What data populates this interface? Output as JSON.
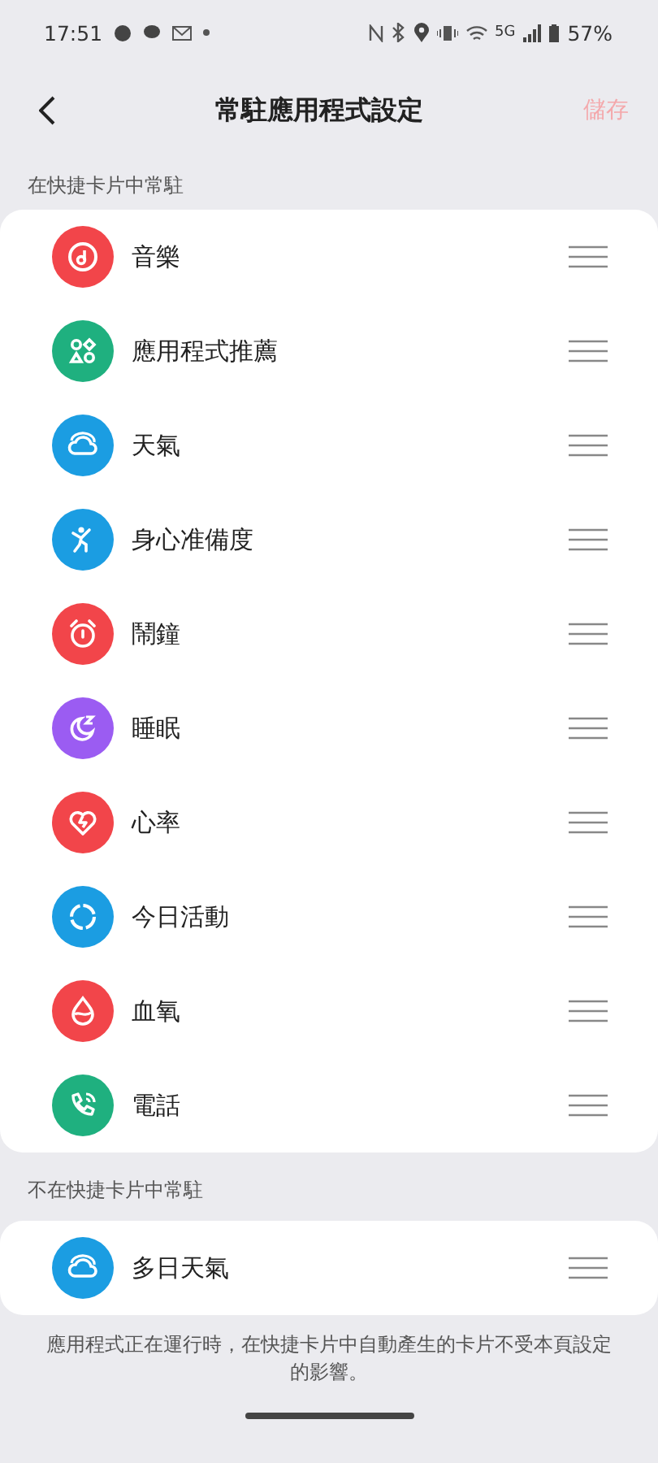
{
  "status_bar": {
    "time": "17:51",
    "network": "5G",
    "battery": "57%"
  },
  "header": {
    "title": "常駐應用程式設定",
    "save": {
      "label": "儲存",
      "disabled": true
    }
  },
  "sections": [
    {
      "label": "在快捷卡片中常駐",
      "items": [
        {
          "name": "音樂",
          "color": "#f2454a"
        },
        {
          "name": "應用程式推薦",
          "color": "#1fb07f"
        },
        {
          "name": "天氣",
          "color": "#1b9de2"
        },
        {
          "name": "身心准備度",
          "color": "#1b9de2"
        },
        {
          "name": "鬧鐘",
          "color": "#f2454a"
        },
        {
          "name": "睡眠",
          "color": "#9b5cf2"
        },
        {
          "name": "心率",
          "color": "#f2454a"
        },
        {
          "name": "今日活動",
          "color": "#1b9de2"
        },
        {
          "name": "血氧",
          "color": "#f2454a"
        },
        {
          "name": "電話",
          "color": "#1fb07f"
        }
      ]
    },
    {
      "label": "不在快捷卡片中常駐",
      "items": [
        {
          "name": "多日天氣",
          "color": "#1b9de2"
        }
      ]
    }
  ],
  "footer": "應用程式正在運行時，在快捷卡片中自動產生的卡片不受本頁設定的影響。"
}
